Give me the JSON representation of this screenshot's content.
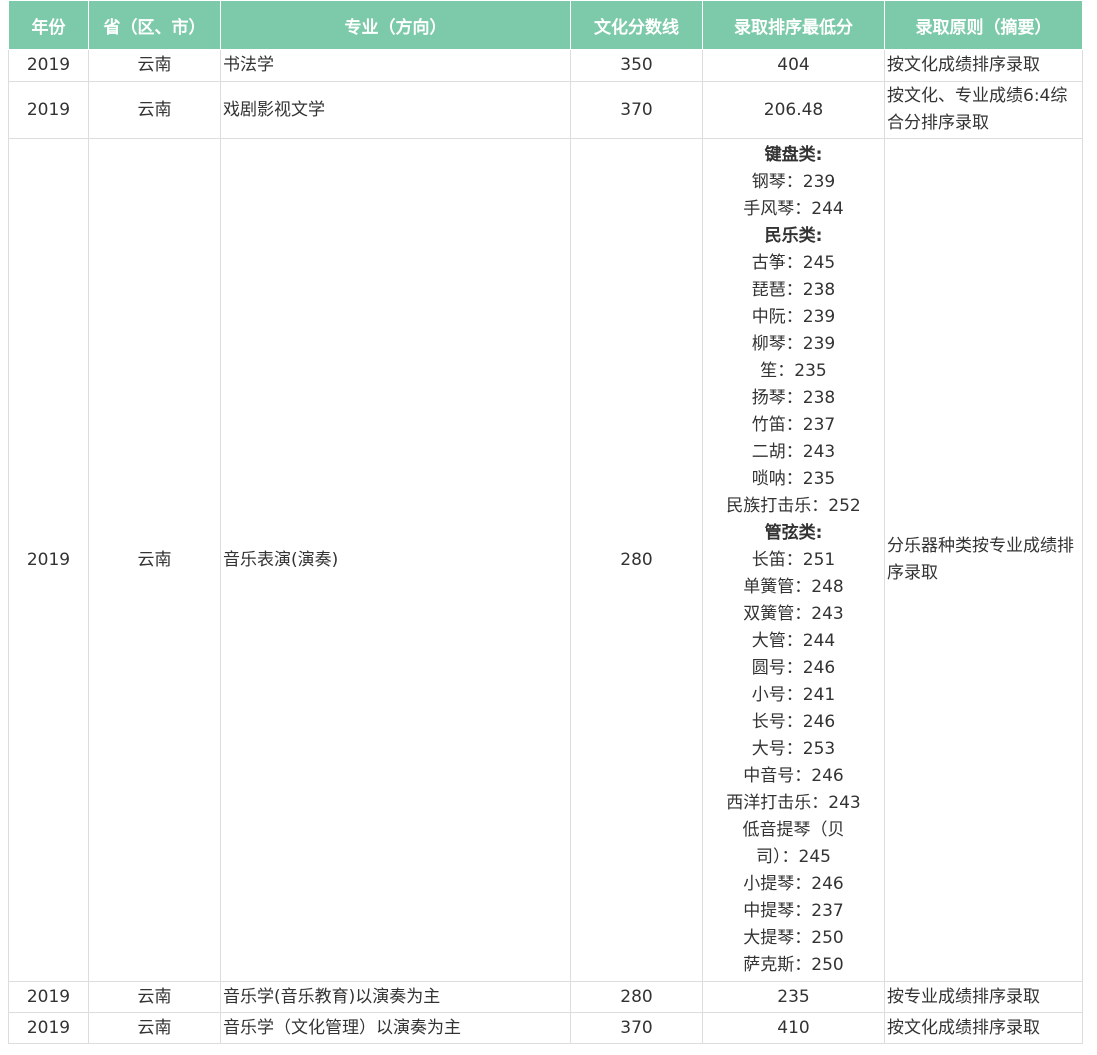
{
  "columns": [
    "年份",
    "省（区、市）",
    "专业（方向）",
    "文化分数线",
    "录取排序最低分",
    "录取原则（摘要）"
  ],
  "rows": [
    {
      "year": "2019",
      "province": "云南",
      "major": "书法学",
      "culture_line": "350",
      "min_score": "404",
      "principle": "按文化成绩排序录取"
    },
    {
      "year": "2019",
      "province": "云南",
      "major": "戏剧影视文学",
      "culture_line": "370",
      "min_score": "206.48",
      "principle": "按文化、专业成绩6:4综合分排序录取"
    },
    {
      "year": "2019",
      "province": "云南",
      "major": "音乐表演(演奏)",
      "culture_line": "280",
      "principle": "分乐器种类按专业成绩排序录取",
      "min_score_lines": [
        {
          "text": "键盘类:",
          "bold": true
        },
        {
          "text": "钢琴：239"
        },
        {
          "text": "手风琴：244"
        },
        {
          "text": "民乐类:",
          "bold": true
        },
        {
          "text": "古筝：245"
        },
        {
          "text": "琵琶：238"
        },
        {
          "text": "中阮：239"
        },
        {
          "text": "柳琴：239"
        },
        {
          "text": "笙：235"
        },
        {
          "text": "扬琴：238"
        },
        {
          "text": "竹笛：237"
        },
        {
          "text": "二胡：243"
        },
        {
          "text": "唢呐：235"
        },
        {
          "text": "民族打击乐：252"
        },
        {
          "text": "管弦类:",
          "bold": true
        },
        {
          "text": "长笛：251"
        },
        {
          "text": "单簧管：248"
        },
        {
          "text": "双簧管：243"
        },
        {
          "text": "大管：244"
        },
        {
          "text": "圆号：246"
        },
        {
          "text": "小号：241"
        },
        {
          "text": "长号：246"
        },
        {
          "text": "大号：253"
        },
        {
          "text": "中音号：246"
        },
        {
          "text": "西洋打击乐：243"
        },
        {
          "text": "低音提琴（贝司）：245",
          "wrap": true
        },
        {
          "text": "小提琴：246"
        },
        {
          "text": "中提琴：237"
        },
        {
          "text": "大提琴：250"
        },
        {
          "text": "萨克斯：250"
        }
      ]
    },
    {
      "year": "2019",
      "province": "云南",
      "major": "音乐学(音乐教育)以演奏为主",
      "culture_line": "280",
      "min_score": "235",
      "principle": "按专业成绩排序录取"
    },
    {
      "year": "2019",
      "province": "云南",
      "major": "音乐学（文化管理）以演奏为主",
      "culture_line": "370",
      "min_score": "410",
      "principle": "按文化成绩排序录取"
    }
  ]
}
